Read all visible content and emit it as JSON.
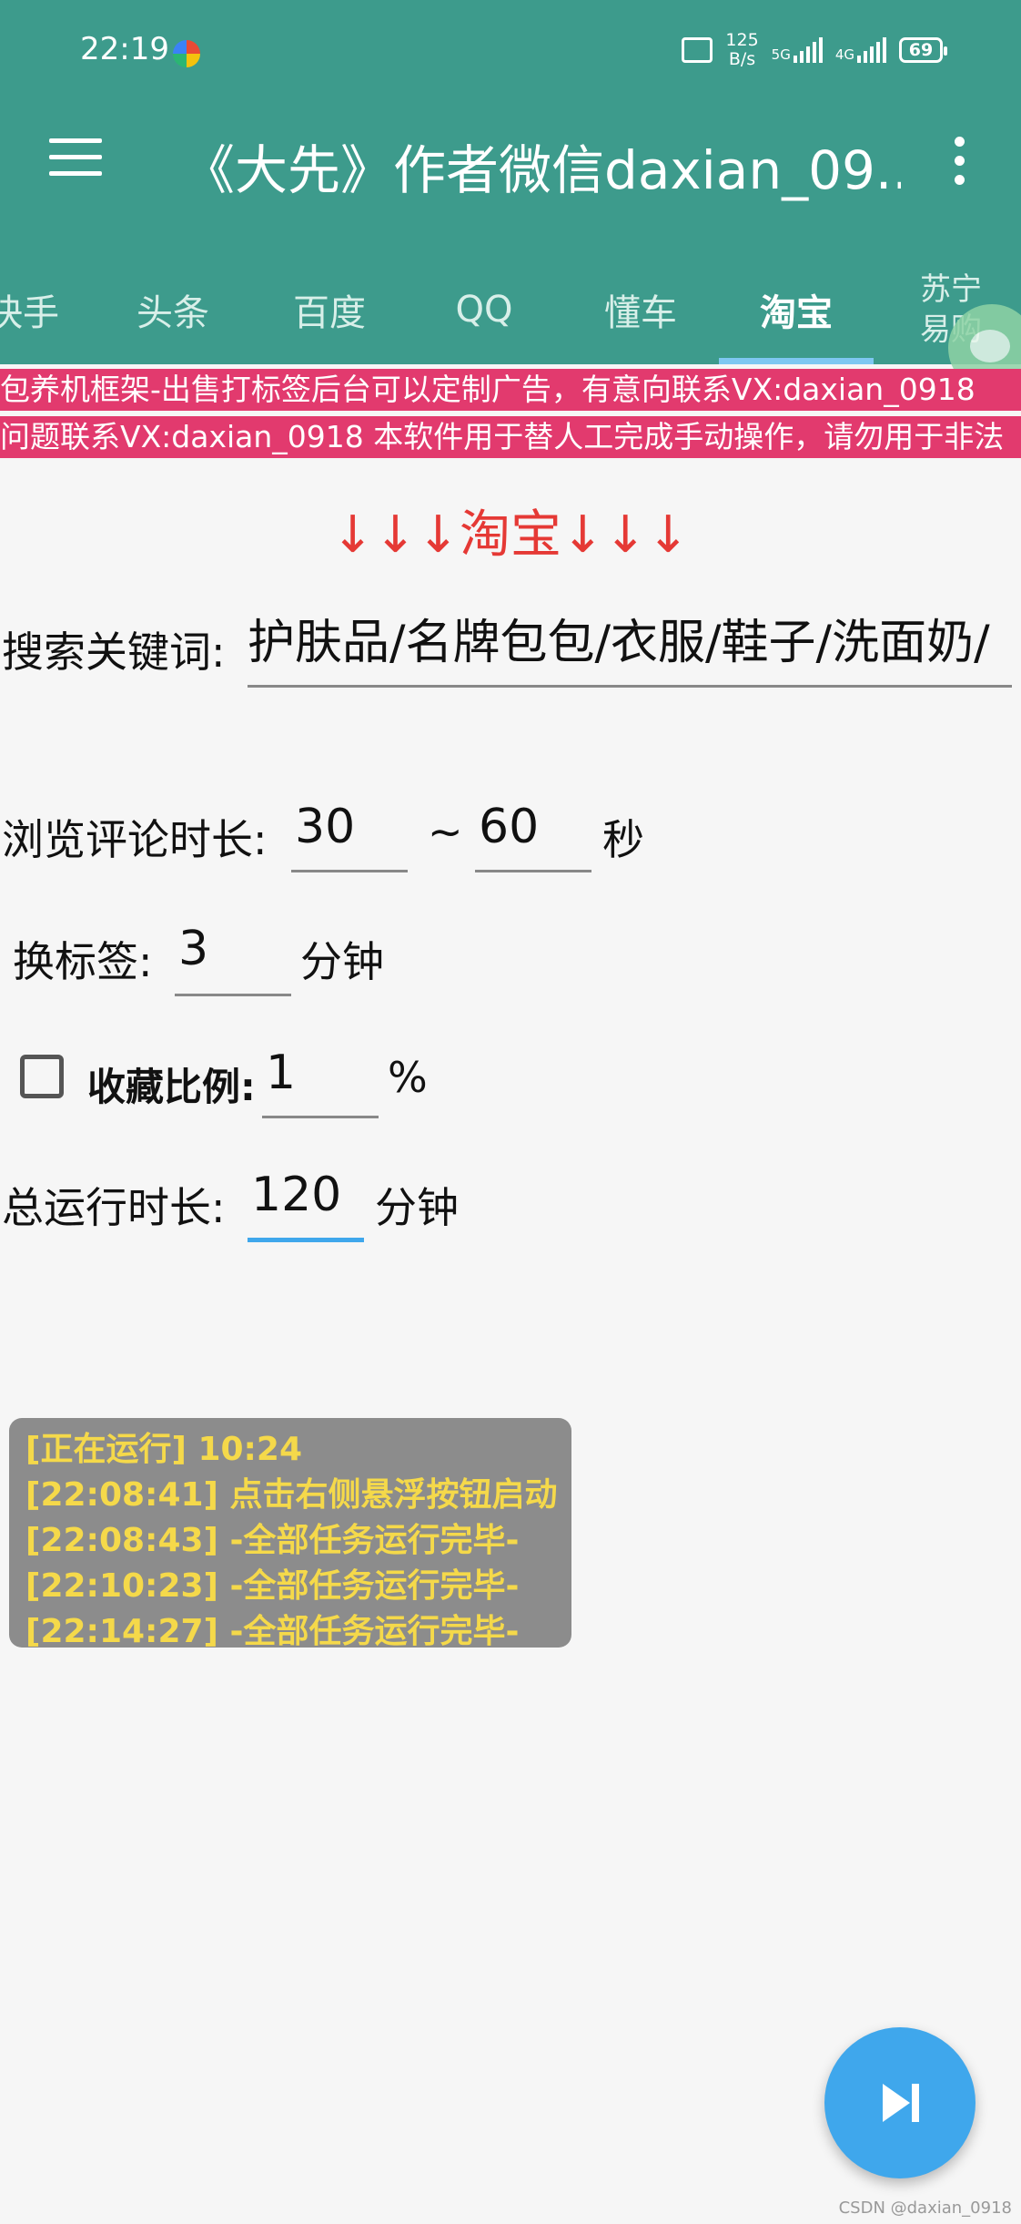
{
  "status_bar": {
    "time": "22:19",
    "net_speed_value": "125",
    "net_speed_unit": "B/s",
    "signal1": "5G",
    "signal2": "4G",
    "battery": "69"
  },
  "app_bar": {
    "title": "《大先》作者微信daxian_09..."
  },
  "tabs": [
    {
      "label": "快手"
    },
    {
      "label": "头条"
    },
    {
      "label": "百度"
    },
    {
      "label": "QQ"
    },
    {
      "label": "懂车"
    },
    {
      "label": "淘宝"
    },
    {
      "label": "苏宁易购",
      "line1": "苏宁",
      "line2": "易购"
    }
  ],
  "active_tab": "淘宝",
  "marquee": {
    "line1": "包养机框架-出售打标签后台可以定制广告，有意向联系VX:daxian_0918",
    "line2": "问题联系VX:daxian_0918 本软件用于替人工完成手动操作，请勿用于非法"
  },
  "section_title": "↓↓↓淘宝↓↓↓",
  "form": {
    "keyword_label": "搜索关键词:",
    "keyword_value": "护肤品/名牌包包/衣服/鞋子/洗面奶/",
    "browse_label": "浏览评论时长:",
    "browse_min": "30",
    "browse_sep": "~",
    "browse_max": "60",
    "browse_unit": "秒",
    "switch_label": "换标签:",
    "switch_value": "3",
    "switch_unit": "分钟",
    "favorite_label": "收藏比例:",
    "favorite_value": "1",
    "favorite_unit": "%",
    "favorite_checked": false,
    "total_label": "总运行时长:",
    "total_value": "120",
    "total_unit": "分钟"
  },
  "log": [
    "[正在运行] 10:24",
    "[22:08:41] 点击右侧悬浮按钮启动",
    "[22:08:43] -全部任务运行完毕-",
    "[22:10:23] -全部任务运行完毕-",
    "[22:14:27] -全部任务运行完毕-"
  ],
  "watermark": "CSDN @daxian_0918",
  "colors": {
    "app_bar": "#3d9b8c",
    "marquee": "#e23a6e",
    "section_title": "#e53935",
    "active_input": "#3fa7ec",
    "log_text": "#f5d94a",
    "fab": "#3fa7ec"
  }
}
